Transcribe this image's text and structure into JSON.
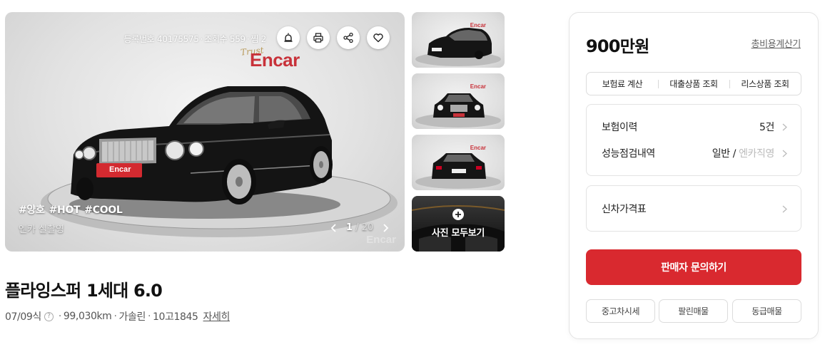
{
  "gallery": {
    "meta": {
      "reg_label": "등록번호 40175575",
      "views": "조회수 559",
      "likes": "찜 2"
    },
    "brand": "Encar",
    "brand_tagline": "Trust",
    "plate_text": "Encar",
    "hashtags": [
      "#양호",
      "#HOT",
      "#COOL"
    ],
    "source_label": "엔카 실촬영",
    "pager": {
      "current": "1",
      "total": "20"
    },
    "watermark": "Encar",
    "thumb_brand": "Encar",
    "view_all_label": "사진 모두보기",
    "actions": [
      "siren-icon",
      "print-icon",
      "share-icon",
      "heart-icon"
    ]
  },
  "car": {
    "title": "플라잉스퍼 1세대 6.0",
    "year": "07/09식",
    "mileage": "99,030km",
    "fuel": "가솔린",
    "plate": "10고1845",
    "detail_link": "자세히"
  },
  "panel": {
    "price_number": "900",
    "price_unit": "만원",
    "calc_link": "총비용계산기",
    "tabs": [
      "보험료 계산",
      "대출상품 조회",
      "리스상품 조회"
    ],
    "insurance": {
      "label": "보험이력",
      "value": "5건"
    },
    "inspection": {
      "label": "성능점검내역",
      "value": "일반",
      "value_muted": "엔카직영",
      "divider": " / "
    },
    "new_price": {
      "label": "신차가격표"
    },
    "cta": "판매자 문의하기",
    "links": [
      "중고차시세",
      "팔린매물",
      "동급매물"
    ]
  },
  "colors": {
    "accent": "#d9292f",
    "brand_red": "#c8323a",
    "border": "#e3e3e3"
  }
}
